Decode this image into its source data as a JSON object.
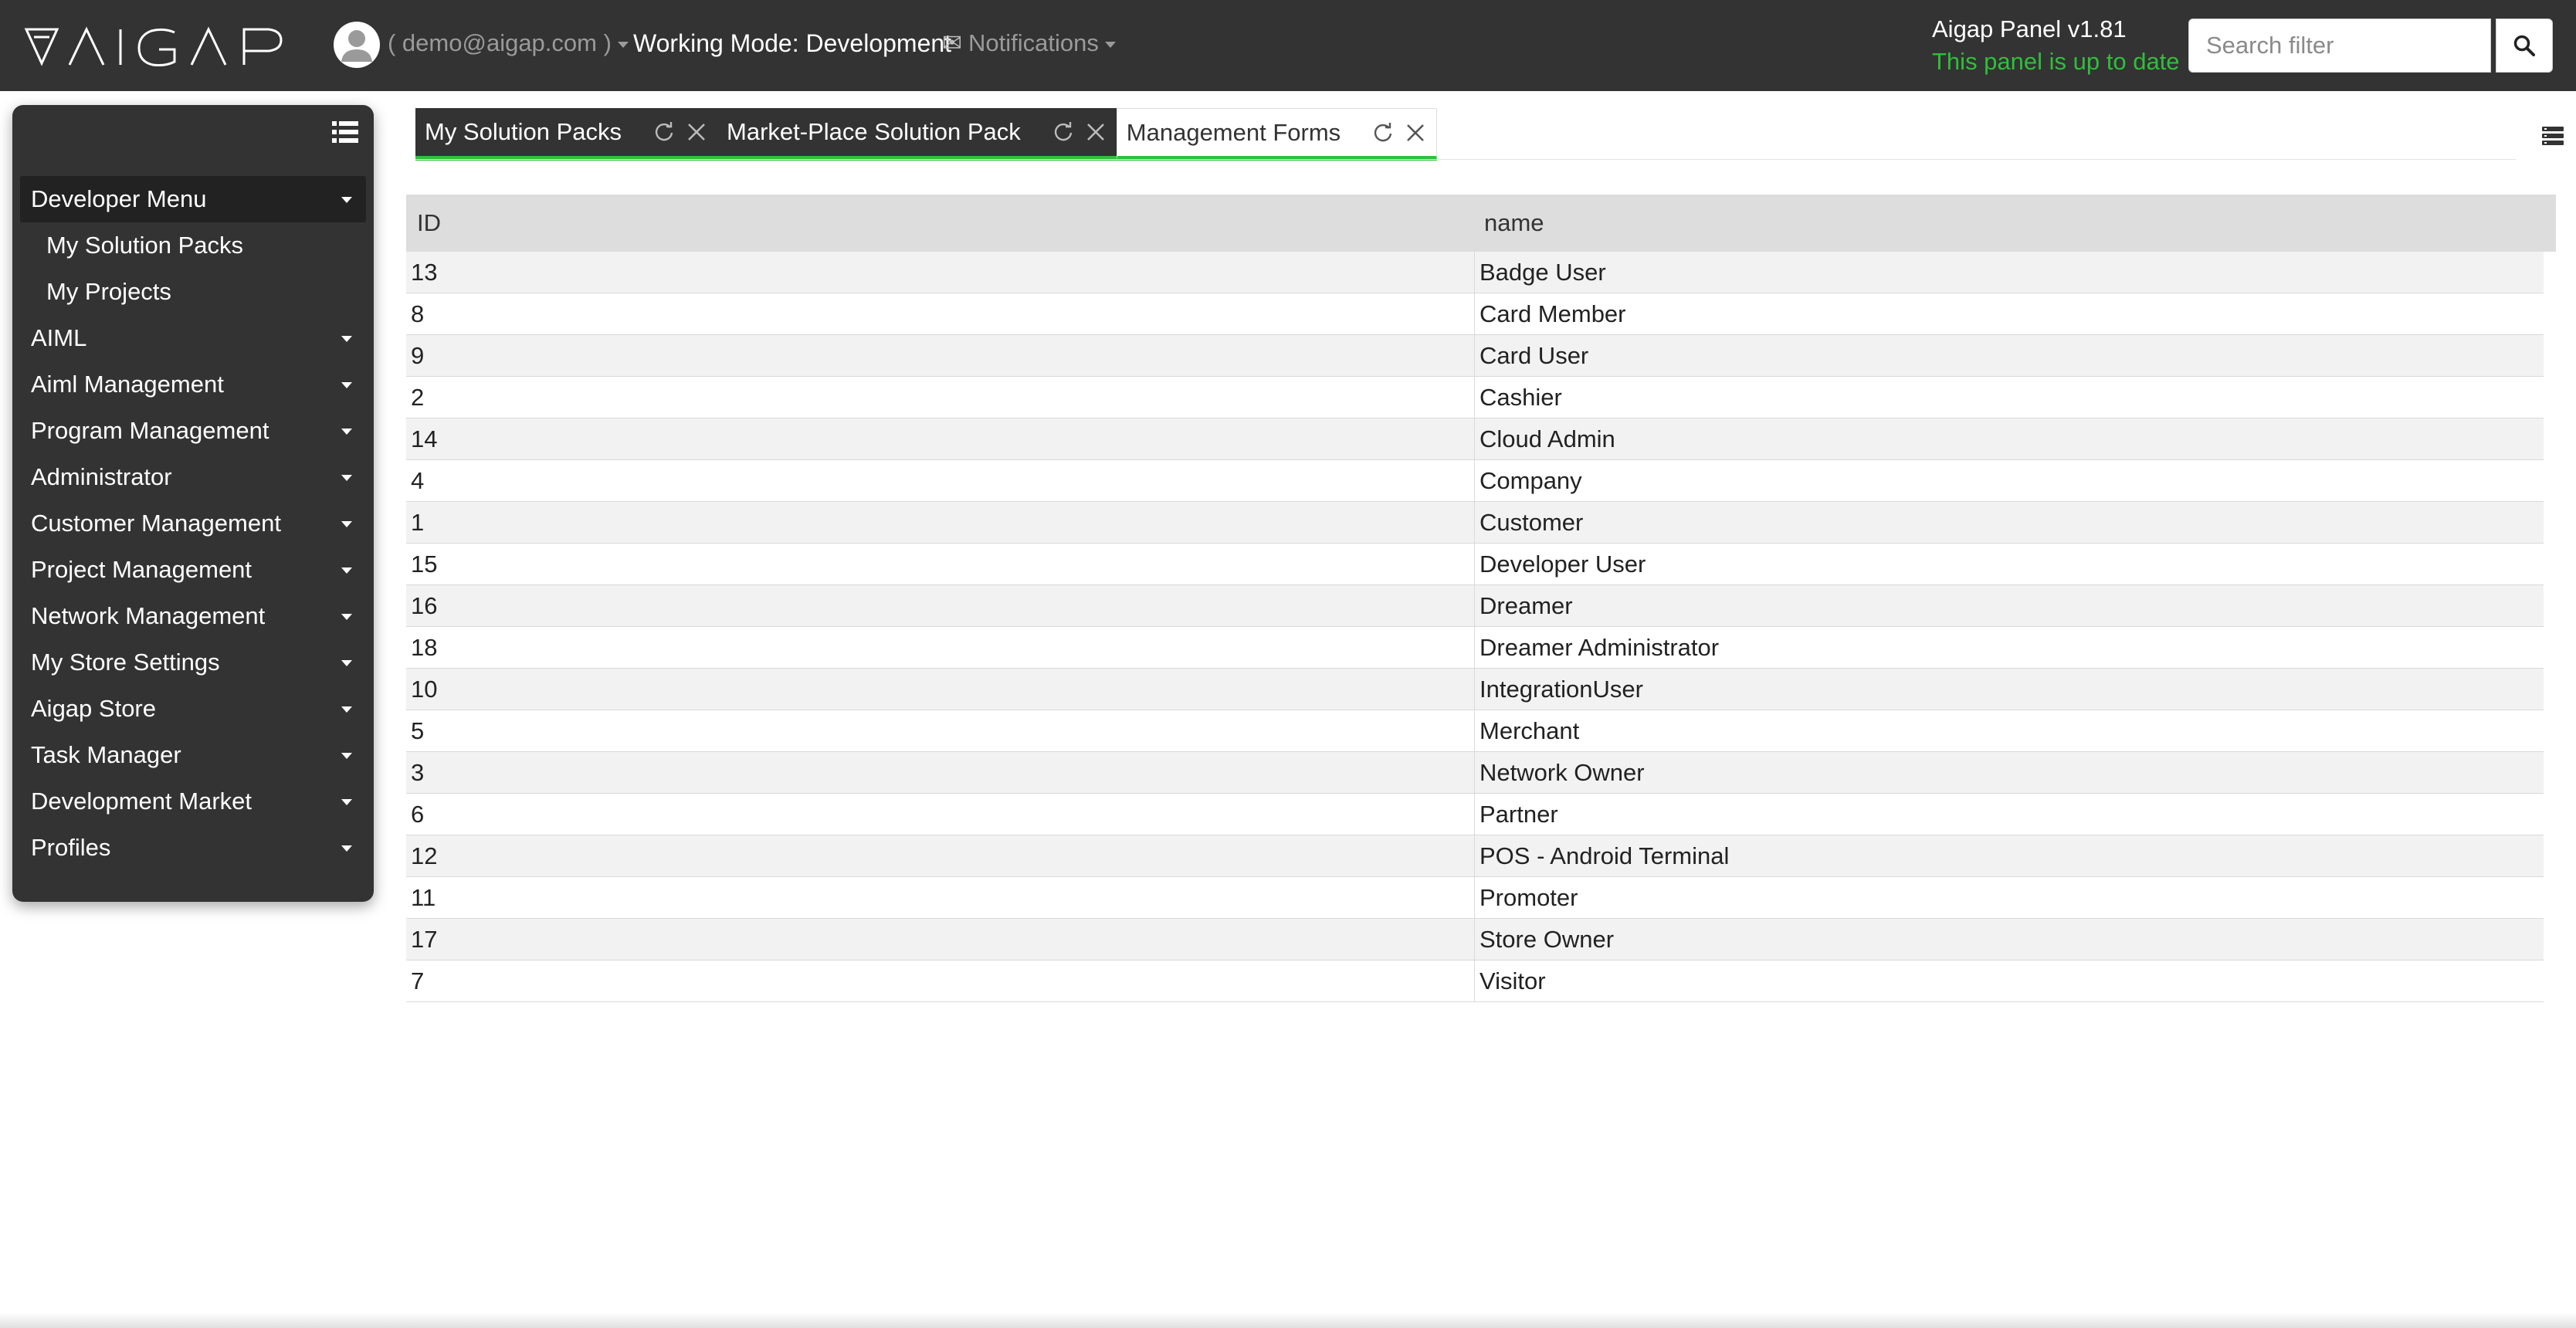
{
  "header": {
    "logo_text": "AIGAP",
    "user_email": "( demo@aigap.com )",
    "working_mode": "Working Mode: Development",
    "notifications_label": "Notifications",
    "panel_version": "Aigap Panel v1.81",
    "panel_status": "This panel is up to date",
    "search_placeholder": "Search filter",
    "status_color": "#2fbf3a"
  },
  "sidebar": {
    "items": [
      {
        "label": "Developer Menu",
        "active": true,
        "has_caret": true
      },
      {
        "label": "My Solution Packs",
        "sub": true
      },
      {
        "label": "My Projects",
        "sub": true
      },
      {
        "label": "AIML",
        "has_caret": true
      },
      {
        "label": "Aiml Management",
        "has_caret": true
      },
      {
        "label": "Program Management",
        "has_caret": true
      },
      {
        "label": "Administrator",
        "has_caret": true
      },
      {
        "label": "Customer Management",
        "has_caret": true
      },
      {
        "label": "Project Management",
        "has_caret": true
      },
      {
        "label": "Network Management",
        "has_caret": true
      },
      {
        "label": "My Store Settings",
        "has_caret": true
      },
      {
        "label": "Aigap Store",
        "has_caret": true
      },
      {
        "label": "Task Manager",
        "has_caret": true
      },
      {
        "label": "Development Market",
        "has_caret": true
      },
      {
        "label": "Profiles",
        "has_caret": true
      }
    ]
  },
  "tabs": [
    {
      "label": "My Solution Packs",
      "style": "dark"
    },
    {
      "label": "Market-Place Solution Pack",
      "style": "dark"
    },
    {
      "label": "Management Forms",
      "style": "light"
    }
  ],
  "table": {
    "columns": [
      "ID",
      "name"
    ],
    "rows": [
      {
        "id": "13",
        "name": "Badge User"
      },
      {
        "id": "8",
        "name": "Card Member"
      },
      {
        "id": "9",
        "name": "Card User"
      },
      {
        "id": "2",
        "name": "Cashier"
      },
      {
        "id": "14",
        "name": "Cloud Admin"
      },
      {
        "id": "4",
        "name": "Company"
      },
      {
        "id": "1",
        "name": "Customer"
      },
      {
        "id": "15",
        "name": "Developer User"
      },
      {
        "id": "16",
        "name": "Dreamer"
      },
      {
        "id": "18",
        "name": "Dreamer Administrator"
      },
      {
        "id": "10",
        "name": "IntegrationUser"
      },
      {
        "id": "5",
        "name": "Merchant"
      },
      {
        "id": "3",
        "name": "Network Owner"
      },
      {
        "id": "6",
        "name": "Partner"
      },
      {
        "id": "12",
        "name": "POS - Android Terminal"
      },
      {
        "id": "11",
        "name": "Promoter"
      },
      {
        "id": "17",
        "name": "Store Owner"
      },
      {
        "id": "7",
        "name": "Visitor"
      }
    ]
  },
  "icons": {
    "logo": "aigap-logo",
    "avatar": "user-avatar-icon",
    "notifications": "envelope-icon",
    "search": "search-icon",
    "sidebar_toggle": "list-icon",
    "tab_refresh": "refresh-icon",
    "tab_close": "close-icon",
    "panel_options": "stack-icon"
  }
}
